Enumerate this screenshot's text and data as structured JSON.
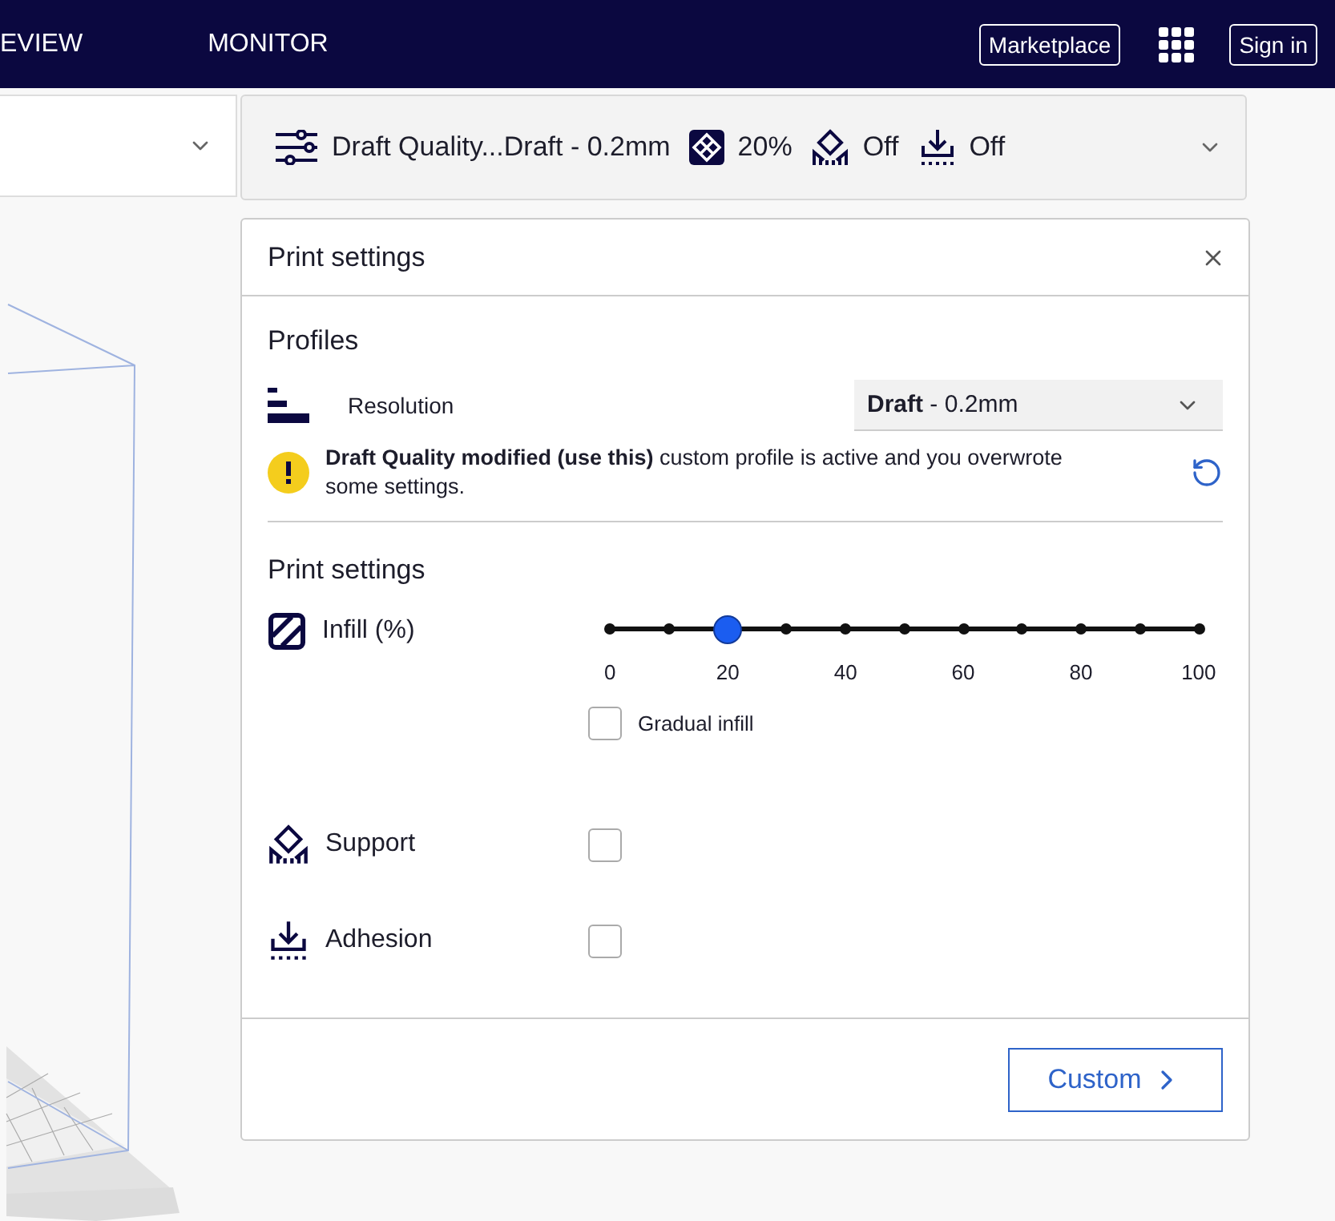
{
  "top_bar": {
    "tabs": [
      {
        "label": "EVIEW"
      },
      {
        "label": "MONITOR"
      }
    ],
    "marketplace": "Marketplace",
    "sign_in": "Sign in"
  },
  "toolbar": {
    "profile": "Draft Quality...Draft - 0.2mm",
    "infill": "20%",
    "support": "Off",
    "adhesion": "Off"
  },
  "panel": {
    "title": "Print settings",
    "profiles_heading": "Profiles",
    "resolution_label": "Resolution",
    "resolution_value": "**Draft** - 0.2mm",
    "notice": "**Draft Quality modified (use this)** custom profile is active and you overwrote some settings.",
    "settings_heading": "Print settings",
    "infill": {
      "label": "Infill (%)",
      "level": 0.2,
      "ticks": [
        "0",
        "20",
        "40",
        "60",
        "80",
        "100"
      ]
    },
    "gradual": {
      "label": "Gradual infill",
      "checked": false
    },
    "support": {
      "label": "Support",
      "checked": false
    },
    "adhesion": {
      "label": "Adhesion",
      "checked": false
    },
    "custom_button": "Custom"
  }
}
